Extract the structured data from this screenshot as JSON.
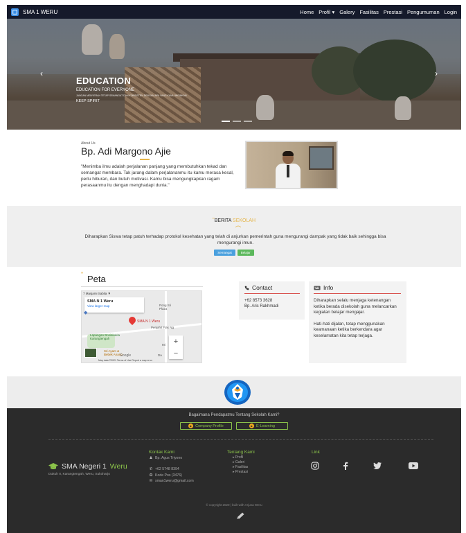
{
  "nav": {
    "brand": "SMA 1 WERU",
    "links": [
      "Home",
      "Profil ▾",
      "Galery",
      "Fasilitas",
      "Prestasi",
      "Pengumuman",
      "Login"
    ]
  },
  "hero": {
    "title": "EDUCATION",
    "subtitle": "EDUCATION FOR EVERYONE",
    "tiny": "JANGAN MENYERAH TETAP SEMANGAT DAN KONSISTEN DENGAN APA YANG KAMU INGINKAN",
    "tag": "KEEP SPIRIT",
    "prev": "‹",
    "next": "›"
  },
  "about": {
    "eyebrow": "About Us",
    "name": "Bp. Adi Margono Ajie",
    "quote": "\"Menimba ilmu adalah perjalanan panjang yang membutuhkan tekad dan semangat membara. Tak jarang dalam perjalananmu itu kamu merasa kesal, perlu hiburan, dan butuh motivasi. Kamu bisa mengungkapkan ragam perasaanmu itu dengan menghadapi dunia.\""
  },
  "news": {
    "quote": "\"",
    "title_a": "BERITA",
    "title_b": "SEKOLAH",
    "text": "Diharapkan Siswa tetap patuh terhadap protokol kesehatan yang telah di anjurkan pemerintah guna mengurangi dampak yang tidak baik sehingga bisa mengurangi imun.",
    "tags": [
      "Semangat",
      "Belajar"
    ]
  },
  "peta": {
    "quote": "\"",
    "title": "Peta",
    "map": {
      "top": "7 Masjami Sabila ▼",
      "card_title": "SMA N 1 Weru",
      "card_link": "View larger map",
      "pin_label": "SMA N 1 Weru",
      "labels": [
        "Pong Sri\nPlaza",
        "Penjahit Fiak Ng",
        "Lapangan Bosiakukia\nKarangtengah",
        "Mi",
        "Sri Ayam &\nBebek Anang",
        "Da"
      ],
      "google": "Google",
      "footer": "Map data ©2021   Terms of Use   Report a map error",
      "zoom_in": "+",
      "zoom_out": "−"
    }
  },
  "contact": {
    "title": "Contact",
    "phone": "+62 8573 3628",
    "person": "Bp. Aris Rakhmadi"
  },
  "info": {
    "title": "Info",
    "p1": "Diharapkan selalu menjaga ketenangan ketika berada disekolah guna melancarkan kegiatan belajar mengajar.",
    "p2": "Hati-hati dijalan, tetap menggunakan keamanaan ketika berkendara agar keselamatan kita tetap terjaga."
  },
  "footer": {
    "question": "Bagaimana Pendapatmu Tentang Sekolah Kami?",
    "btn_profile": "Company Profile",
    "btn_elearning": "E-Learning",
    "brand_a": "SMA Negeri 1",
    "brand_b": "Weru",
    "address": "Dukuh II, Karangtengah, Weru, Sukoharjo",
    "contact_title": "Kontak Kami",
    "contact_person": "Bp. Agus Triyono",
    "contact_phone": "+62 5748 8394",
    "contact_postal": "Kode Pos (3476)",
    "contact_email": "sman1weru@gmail.com",
    "about_title": "Tentang Kami",
    "about_links": [
      "▸ Profil",
      "▸ Galeri",
      "▸ Fasilitas",
      "▸ Prestasi"
    ],
    "link_title": "Link",
    "copyright": "© copyright 2020 | built with Arjuna Weru"
  },
  "colors": {
    "nav_bg": "#151a2b",
    "accent_gold": "#e5b54a",
    "accent_green": "#8bc34a",
    "rule_red": "#d9534f",
    "footer_bg": "#2b2b2b"
  }
}
